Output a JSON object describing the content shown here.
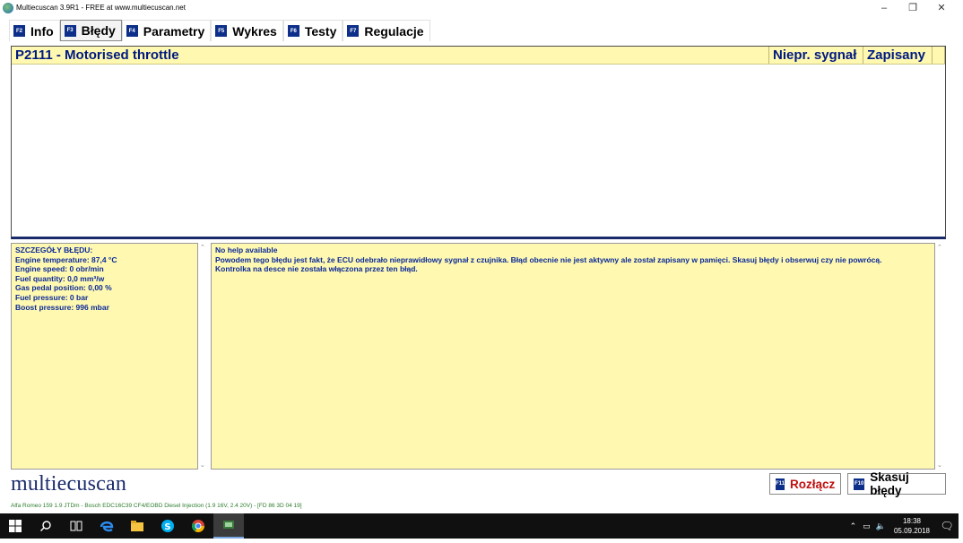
{
  "window": {
    "title": "Multiecuscan 3.9R1 - FREE at www.multiecuscan.net",
    "min_glyph": "–",
    "max_glyph": "❐",
    "close_glyph": "✕"
  },
  "tabs": [
    {
      "key": "F2",
      "label": "Info",
      "active": false
    },
    {
      "key": "F3",
      "label": "Błędy",
      "active": true
    },
    {
      "key": "F4",
      "label": "Parametry",
      "active": false
    },
    {
      "key": "F5",
      "label": "Wykres",
      "active": false
    },
    {
      "key": "F6",
      "label": "Testy",
      "active": false
    },
    {
      "key": "F7",
      "label": "Regulacje",
      "active": false
    }
  ],
  "error_table": {
    "code": "P2111 - Motorised throttle",
    "signal": "Niepr. sygnał",
    "saved": "Zapisany"
  },
  "details": {
    "heading": "SZCZEGÓŁY BŁĘDU:",
    "lines": [
      "Engine temperature: 87,4 °C",
      "Engine speed: 0 obr/min",
      "Fuel quantity: 0,0 mm³/w",
      "Gas pedal position: 0,00 %",
      "Fuel pressure: 0 bar",
      "Boost pressure: 996 mbar"
    ]
  },
  "help": {
    "line1": "No help available",
    "line2": "Powodem tego błędu jest fakt, że ECU odebrało nieprawidłowy sygnał z czujnika. Błąd obecnie nie jest aktywny ale został zapisany w pamięci. Skasuj błędy i obserwuj czy nie powrócą.",
    "line3": "Kontrolka na desce nie została włączona przez ten błąd."
  },
  "logo_text": "multiecuscan",
  "buttons": {
    "disconnect": {
      "key": "F11",
      "label": "Rozłącz"
    },
    "clear": {
      "key": "F10",
      "label": "Skasuj błędy"
    }
  },
  "status_bar": "Alfa Romeo 159 1.9 JTDm - Bosch EDC16C39 CF4/EOBD Diesel Injection (1.9 16V, 2.4 20V) - [FD 86 3D 04 19]",
  "taskbar": {
    "time": "18:38",
    "date": "05.09.2018",
    "icons": [
      "windows-start-icon",
      "search-icon",
      "task-view-icon",
      "edge-icon",
      "file-explorer-icon",
      "skype-icon",
      "chrome-icon",
      "multiecuscan-icon"
    ]
  },
  "colors": {
    "panel_bg": "#fff8b0",
    "text_blue": "#0a2a9a",
    "fkey_bg": "#0d2f8a",
    "disconnect_red": "#c01010"
  }
}
